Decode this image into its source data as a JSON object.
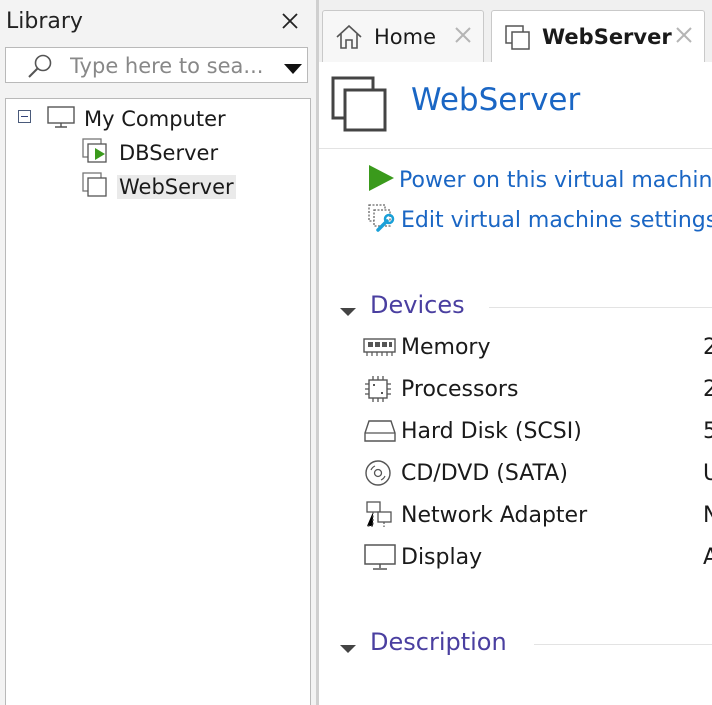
{
  "library": {
    "title": "Library",
    "search_placeholder": "Type here to sea...",
    "tree": {
      "root_label": "My Computer",
      "children": [
        {
          "label": "DBServer",
          "state": "running"
        },
        {
          "label": "WebServer",
          "state": "stopped",
          "selected": true
        }
      ]
    }
  },
  "tabs": [
    {
      "label": "Home",
      "icon": "home-icon",
      "active": false
    },
    {
      "label": "WebServer",
      "icon": "vm-icon",
      "active": true
    }
  ],
  "vm": {
    "title": "WebServer",
    "actions": [
      {
        "label": "Power on this virtual machine",
        "icon": "play-icon"
      },
      {
        "label": "Edit virtual machine settings",
        "icon": "settings-icon"
      }
    ],
    "devices_heading": "Devices",
    "devices": [
      {
        "name": "Memory",
        "value": "2",
        "icon": "memory-icon"
      },
      {
        "name": "Processors",
        "value": "2",
        "icon": "processor-icon"
      },
      {
        "name": "Hard Disk (SCSI)",
        "value": "5",
        "icon": "hard-disk-icon"
      },
      {
        "name": "CD/DVD (SATA)",
        "value": "U",
        "icon": "cd-dvd-icon"
      },
      {
        "name": "Network Adapter",
        "value": "N",
        "icon": "network-adapter-icon"
      },
      {
        "name": "Display",
        "value": "A",
        "icon": "display-icon"
      }
    ],
    "description_heading": "Description"
  },
  "colors": {
    "link": "#1a66c4",
    "section_heading": "#4a3fa0",
    "play": "#3a9a1c"
  }
}
